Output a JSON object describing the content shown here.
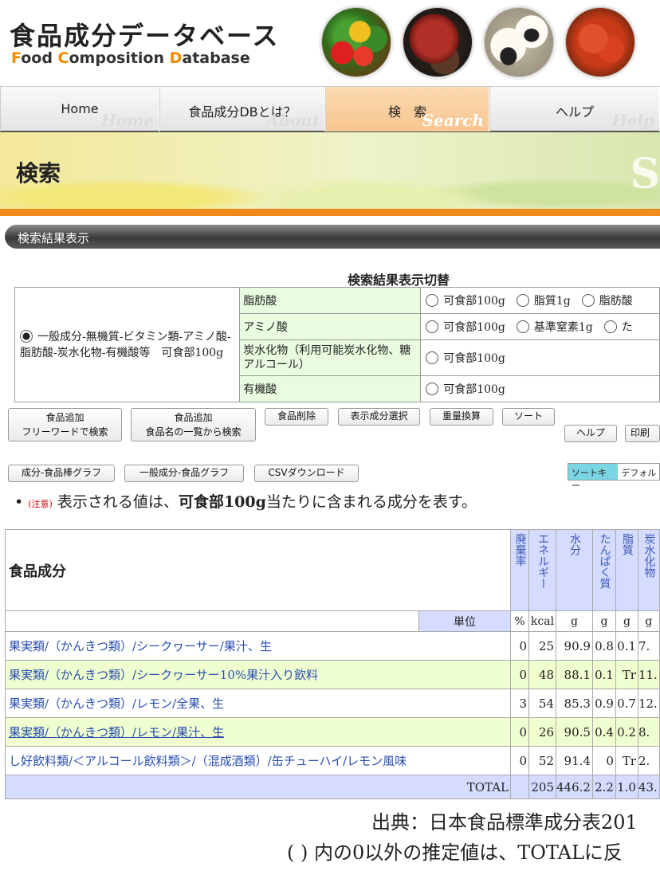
{
  "header": {
    "logo_ja": "食品成分データベース",
    "logo_en": [
      {
        "cap": "F",
        "rest": "ood "
      },
      {
        "cap": "C",
        "rest": "omposition "
      },
      {
        "cap": "D",
        "rest": "atabase"
      }
    ]
  },
  "nav": [
    {
      "label": "Home",
      "sub": "Home",
      "active": false
    },
    {
      "label": "食品成分DBとは？",
      "sub": "About",
      "active": false
    },
    {
      "label": "検　索",
      "sub": "Search",
      "active": true
    },
    {
      "label": "ヘルプ",
      "sub": "Help",
      "active": false
    }
  ],
  "banner": {
    "title": "検索",
    "deco": "S"
  },
  "section_title": "検索結果表示",
  "switcher": {
    "title": "検索結果表示切替",
    "default_option": "一般成分-無機質-ビタミン類-アミノ酸-脂肪酸-炭水化物-有機酸等　可食部100g",
    "rows": [
      {
        "category": "脂肪酸",
        "options": [
          "可食部100g",
          "脂質1g",
          "脂肪酸"
        ]
      },
      {
        "category": "アミノ酸",
        "options": [
          "可食部100g",
          "基準窒素1g",
          "た"
        ]
      },
      {
        "category": "炭水化物（利用可能炭水化物、糖アルコール）",
        "options": [
          "可食部100g"
        ]
      },
      {
        "category": "有機酸",
        "options": [
          "可食部100g"
        ]
      }
    ]
  },
  "buttons": {
    "add_free_l1": "食品追加",
    "add_free_l2": "フリーワードで検索",
    "add_list_l1": "食品追加",
    "add_list_l2": "食品名の一覧から検索",
    "delete": "食品削除",
    "select_component": "表示成分選択",
    "weight_convert": "重量換算",
    "sort": "ソート",
    "help": "ヘルプ",
    "print": "印刷",
    "bar_graph": "成分-食品棒グラフ",
    "general_graph": "一般成分-食品グラフ",
    "csv": "CSVダウンロード"
  },
  "sort_key": {
    "label": "ソートキー",
    "value": "デフォル"
  },
  "note": {
    "caution": "(注意)",
    "pre": "表示される値は、",
    "bold": "可食部100g",
    "post": "当たりに含まれる成分を表す。"
  },
  "results": {
    "heading": "食品成分",
    "unit_label": "単位",
    "columns": [
      {
        "name": "廃棄率",
        "unit": "%"
      },
      {
        "name": "エネルギー",
        "unit": "kcal"
      },
      {
        "name": "水分",
        "unit": "g"
      },
      {
        "name": "たんぱく質",
        "unit": "g"
      },
      {
        "name": "脂質",
        "unit": "g"
      },
      {
        "name": "炭水化物",
        "unit": "g"
      }
    ],
    "rows": [
      {
        "food": "果実類/（かんきつ類）/シークヮーサー/果汁、生",
        "values": [
          "0",
          "25",
          "90.9",
          "0.8",
          "0.1",
          "7."
        ]
      },
      {
        "food": "果実類/（かんきつ類）/シークヮーサー10%果汁入り飲料",
        "values": [
          "0",
          "48",
          "88.1",
          "0.1",
          "Tr",
          "11."
        ]
      },
      {
        "food": "果実類/（かんきつ類）/レモン/全果、生",
        "values": [
          "3",
          "54",
          "85.3",
          "0.9",
          "0.7",
          "12."
        ]
      },
      {
        "food": "果実類/（かんきつ類）/レモン/果汁、生",
        "values": [
          "0",
          "26",
          "90.5",
          "0.4",
          "0.2",
          "8."
        ]
      },
      {
        "food": "し好飲料類/＜アルコール飲料類＞/（混成酒類）/缶チューハイ/レモン風味",
        "values": [
          "0",
          "52",
          "91.4",
          "0",
          "Tr",
          "2."
        ]
      }
    ],
    "total": {
      "label": "TOTAL",
      "values": [
        "",
        "205",
        "446.2",
        "2.2",
        "1.0",
        "43."
      ]
    }
  },
  "footer": {
    "source": "出典：日本食品標準成分表201",
    "estimate": "( ) 内の0以外の推定値は、TOTALに反"
  }
}
